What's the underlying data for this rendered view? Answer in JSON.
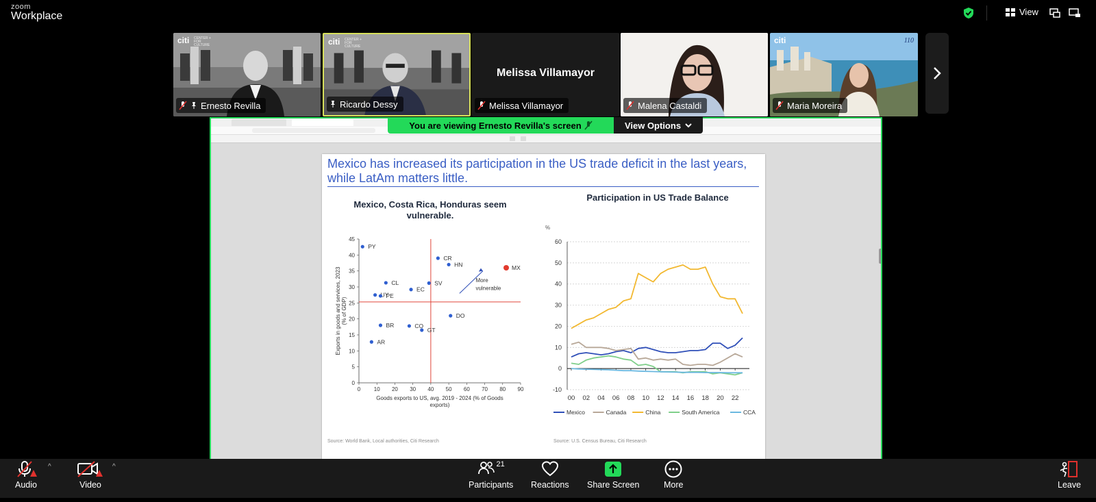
{
  "app": {
    "brand_line1": "zoom",
    "brand_line2": "Workplace",
    "view_label": "View"
  },
  "participants_tiles": [
    {
      "name": "Ernesto Revilla",
      "logo": "citi",
      "logo_sub": "CENTER + FOR CULTURE"
    },
    {
      "name": "Ricardo Dessy",
      "logo": "citi",
      "logo_sub": "CENTER + FOR CULTURE"
    },
    {
      "name": "Melissa Villamayor",
      "center_name": "Melissa Villamayor"
    },
    {
      "name": "Malena Castaldi"
    },
    {
      "name": "Maria Moreira",
      "logo": "citi",
      "logo_right": "110"
    }
  ],
  "share_banner": {
    "viewing_text": "You are viewing  Ernesto Revilla's screen",
    "view_options": "View Options"
  },
  "slide": {
    "title": "Mexico has increased its participation in the US trade deficit in the last years, while LatAm matters little.",
    "source_left": "Source: World Bank, Local authorities, Citi Research",
    "source_right": "Source: U.S. Census Bureau, Citi Research"
  },
  "chart_data": [
    {
      "type": "scatter",
      "title": "Mexico, Costa Rica, Honduras seem vulnerable.",
      "xlabel": "Goods exports to US, avg. 2019 - 2024 (% of Goods exports)",
      "ylabel": "Exports in goods and services, 2023 (% of GDP)",
      "xlim": [
        0,
        90
      ],
      "ylim": [
        0,
        45
      ],
      "xticks": [
        0,
        10,
        20,
        30,
        40,
        50,
        60,
        70,
        80,
        90
      ],
      "yticks": [
        0,
        5,
        10,
        15,
        20,
        25,
        30,
        35,
        40,
        45
      ],
      "ref_x": 40,
      "ref_y": 25.3,
      "annotation": "More vulnerable",
      "points": [
        {
          "label": "PY",
          "x": 2,
          "y": 42.6,
          "color": "#2f5fd0"
        },
        {
          "label": "CR",
          "x": 44,
          "y": 39.0,
          "color": "#2f5fd0"
        },
        {
          "label": "HN",
          "x": 50,
          "y": 37.0,
          "color": "#2f5fd0"
        },
        {
          "label": "MX",
          "x": 82,
          "y": 36.0,
          "color": "#e23b2e"
        },
        {
          "label": "SV",
          "x": 39,
          "y": 31.2,
          "color": "#2f5fd0"
        },
        {
          "label": "CL",
          "x": 15,
          "y": 31.3,
          "color": "#2f5fd0"
        },
        {
          "label": "UY",
          "x": 9,
          "y": 27.5,
          "color": "#2f5fd0"
        },
        {
          "label": "EC",
          "x": 29,
          "y": 29.2,
          "color": "#2f5fd0"
        },
        {
          "label": "PE",
          "x": 12,
          "y": 27.2,
          "color": "#2f5fd0"
        },
        {
          "label": "DO",
          "x": 51,
          "y": 21.0,
          "color": "#2f5fd0"
        },
        {
          "label": "BR",
          "x": 12,
          "y": 18.0,
          "color": "#2f5fd0"
        },
        {
          "label": "CO",
          "x": 28,
          "y": 17.8,
          "color": "#2f5fd0"
        },
        {
          "label": "GT",
          "x": 35,
          "y": 16.5,
          "color": "#2f5fd0"
        },
        {
          "label": "AR",
          "x": 7,
          "y": 12.8,
          "color": "#2f5fd0"
        }
      ]
    },
    {
      "type": "line",
      "title": "Participation in US Trade Balance",
      "unit": "%",
      "ylim": [
        -10,
        60
      ],
      "yticks": [
        -10,
        0,
        10,
        20,
        30,
        40,
        50,
        60
      ],
      "xlim": [
        2000,
        2023
      ],
      "xtick_labels": [
        "00",
        "02",
        "04",
        "06",
        "08",
        "10",
        "12",
        "14",
        "16",
        "18",
        "20",
        "22"
      ],
      "x": [
        2000,
        2001,
        2002,
        2003,
        2004,
        2005,
        2006,
        2007,
        2008,
        2009,
        2010,
        2011,
        2012,
        2013,
        2014,
        2015,
        2016,
        2017,
        2018,
        2019,
        2020,
        2021,
        2022,
        2023
      ],
      "series": [
        {
          "name": "Mexico",
          "color": "#2f4fb8",
          "values": [
            5.5,
            7,
            7.5,
            7,
            6.5,
            7,
            8,
            8.5,
            7.5,
            9.5,
            10,
            9,
            8,
            7.5,
            7.5,
            8,
            8.5,
            8.5,
            9,
            12,
            12,
            9.5,
            11,
            14.5
          ]
        },
        {
          "name": "Canada",
          "color": "#b8a898",
          "values": [
            11.5,
            12.5,
            10,
            10,
            10,
            9.5,
            8.5,
            9,
            9.5,
            4.5,
            5,
            4,
            4.5,
            4,
            4.5,
            2,
            1.5,
            2,
            2,
            1.5,
            3,
            5,
            7,
            5.5
          ]
        },
        {
          "name": "China",
          "color": "#f2b830",
          "values": [
            19,
            21,
            23,
            24,
            26,
            28,
            29,
            32,
            33,
            45,
            43,
            41,
            45,
            47,
            48,
            49,
            47,
            47,
            48,
            40,
            34,
            33,
            33,
            26
          ]
        },
        {
          "name": "South America",
          "color": "#7fcf8a",
          "values": [
            2.5,
            2,
            4,
            5,
            5.5,
            6,
            5.5,
            4.5,
            4,
            1.5,
            2,
            1,
            -1.5,
            -1.5,
            -1.5,
            -2,
            -1.5,
            -1.5,
            -1.5,
            -2.5,
            -2,
            -2.5,
            -3,
            -2
          ]
        },
        {
          "name": "CCA",
          "color": "#6bb8e0",
          "values": [
            0,
            -0.2,
            -0.3,
            -0.4,
            -0.5,
            -0.6,
            -0.8,
            -1,
            -1,
            -1.2,
            -1.3,
            -1.4,
            -1.5,
            -1.6,
            -1.7,
            -1.8,
            -1.8,
            -1.8,
            -1.9,
            -1.9,
            -1.9,
            -2,
            -2,
            -2
          ]
        }
      ]
    }
  ],
  "toolbar": {
    "audio": "Audio",
    "video": "Video",
    "participants": "Participants",
    "participants_count": "21",
    "reactions": "Reactions",
    "share_screen": "Share Screen",
    "more": "More",
    "leave": "Leave"
  }
}
